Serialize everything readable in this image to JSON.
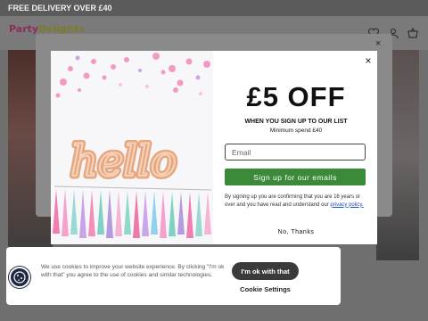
{
  "page": {
    "delivery_banner": "FREE DELIVERY OVER £40",
    "logo_part1": "Party",
    "logo_part2": "Delights"
  },
  "modal": {
    "headline": "£5 OFF",
    "subheadline": "WHEN YOU SIGN UP TO OUR LIST",
    "min_spend": "Minimum spend £40",
    "email_placeholder": "Email",
    "signup_label": "Sign up for our emails",
    "terms_text": "By signing up you are confirming that you are 16 years or over and you have read and understand our ",
    "privacy_link": "privacy policy.",
    "no_thanks": "No, Thanks",
    "close_symbol": "×",
    "balloon_word": "hello"
  },
  "cookie_bar": {
    "text": "We use cookies to improve your website experience. By clicking \"I'm ok with that\" you agree to the use of cookies and similar technologies.",
    "accept_label": "I'm ok with that",
    "settings_label": "Cookie Settings"
  },
  "colors": {
    "signup_green": "#3a8a3a",
    "link_blue": "#1a4fb3",
    "accept_dark": "#3b3b3b"
  }
}
